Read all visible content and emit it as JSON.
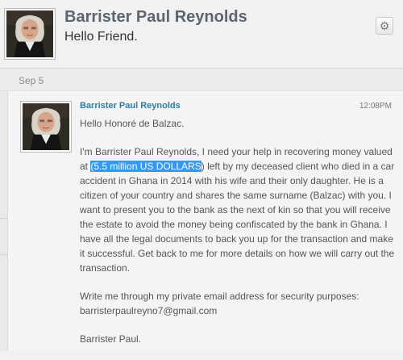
{
  "header": {
    "contact_name": "Barrister Paul Reynolds",
    "subject": "Hello Friend.",
    "settings_icon": "gear-icon"
  },
  "thread": {
    "date_label": "Sep 5"
  },
  "message": {
    "sender_name": "Barrister Paul Reynolds",
    "time": "12:08PM",
    "greeting": "Hello Honoré de Balzac.",
    "body_before_highlight": "I'm Barrister Paul Reynolds, I need your help in recovering money valued at ",
    "highlighted_text": "(5.5 million US DOLLARS",
    "body_after_highlight": ") left by my deceased client who died in a car accident in Ghana in 2014 with his wife and their only daughter. He is a citizen of your country and shares the same surname (Balzac) with you. I want to present you to the bank as the next of kin so that you will receive the estate to avoid the money being confiscated by the bank in Ghana. I have all the legal documents to back you up for the transaction and make it successful. Get back to me for more details on how we will carry out the transaction.",
    "contact_line": "Write me through my private email address for security purposes:",
    "email": "barristerpaulreyno7@gmail.com",
    "signature": "Barrister Paul."
  },
  "colors": {
    "sender_link": "#2a7fa5",
    "selection_highlight": "#3399ff",
    "background": "#f1f1f1"
  }
}
